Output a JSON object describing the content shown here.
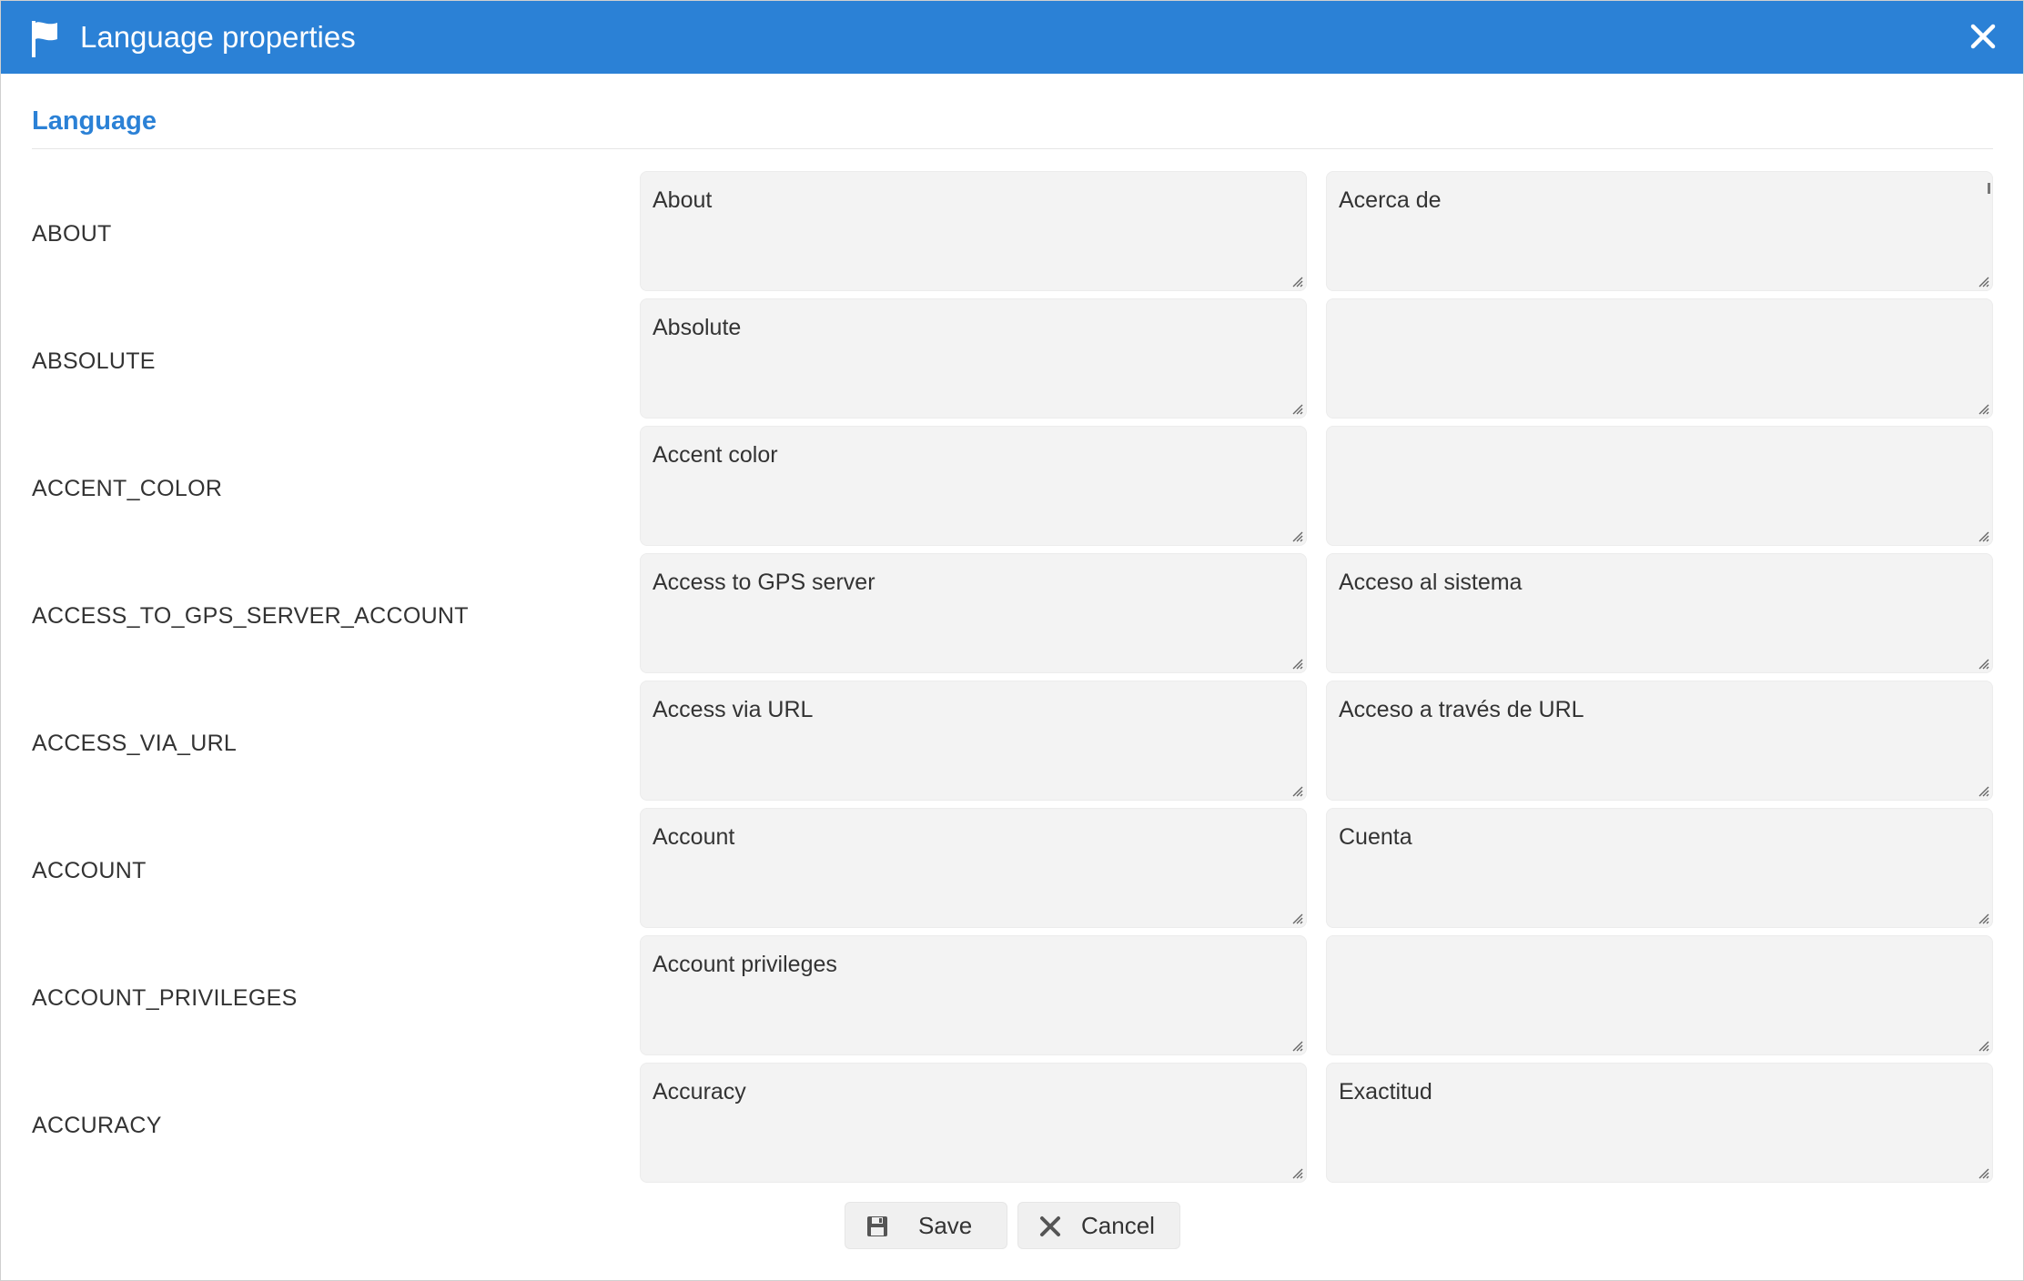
{
  "dialog": {
    "title": "Language properties",
    "title_icon": "flag-icon",
    "close_icon": "close-icon",
    "accent_color": "#2b81d6"
  },
  "section": {
    "title": "Language"
  },
  "rows": [
    {
      "key": "ABOUT",
      "en": "About",
      "es": "Acerca de"
    },
    {
      "key": "ABSOLUTE",
      "en": "Absolute",
      "es": ""
    },
    {
      "key": "ACCENT_COLOR",
      "en": "Accent color",
      "es": ""
    },
    {
      "key": "ACCESS_TO_GPS_SERVER_ACCOUNT",
      "en": "Access to GPS server",
      "es": "Acceso al sistema"
    },
    {
      "key": "ACCESS_VIA_URL",
      "en": "Access via URL",
      "es": "Acceso a través de URL"
    },
    {
      "key": "ACCOUNT",
      "en": "Account",
      "es": "Cuenta"
    },
    {
      "key": "ACCOUNT_PRIVILEGES",
      "en": "Account privileges",
      "es": ""
    },
    {
      "key": "ACCURACY",
      "en": "Accuracy",
      "es": "Exactitud"
    }
  ],
  "buttons": {
    "save_label": "Save",
    "save_icon": "floppy-disk-icon",
    "cancel_label": "Cancel",
    "cancel_icon": "x-icon"
  }
}
